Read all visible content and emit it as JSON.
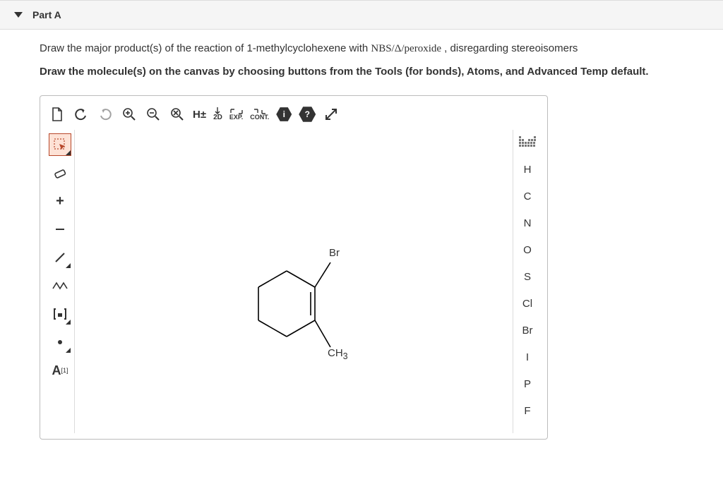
{
  "part": {
    "label": "Part A"
  },
  "question": {
    "line1_a": "Draw the major product(s) of the reaction of 1-methylcyclohexene with ",
    "line1_reagent": "NBS/Δ/peroxide",
    "line1_b": " , disregarding stereoisomers",
    "line2": "Draw the molecule(s) on the canvas by choosing buttons from the Tools (for bonds), Atoms, and Advanced Temp default."
  },
  "toolbar": {
    "h_label": "H±",
    "two_d": "2D",
    "exp": "EXP.",
    "cont": "CONT.",
    "info": "i",
    "help": "?"
  },
  "left_tools": {
    "annotation": "A",
    "annotation_sup": "[1]"
  },
  "atoms": [
    "H",
    "C",
    "N",
    "O",
    "S",
    "Cl",
    "Br",
    "I",
    "P",
    "F"
  ],
  "molecule": {
    "br_label": "Br",
    "ch3_label": "CH",
    "ch3_sub": "3"
  }
}
